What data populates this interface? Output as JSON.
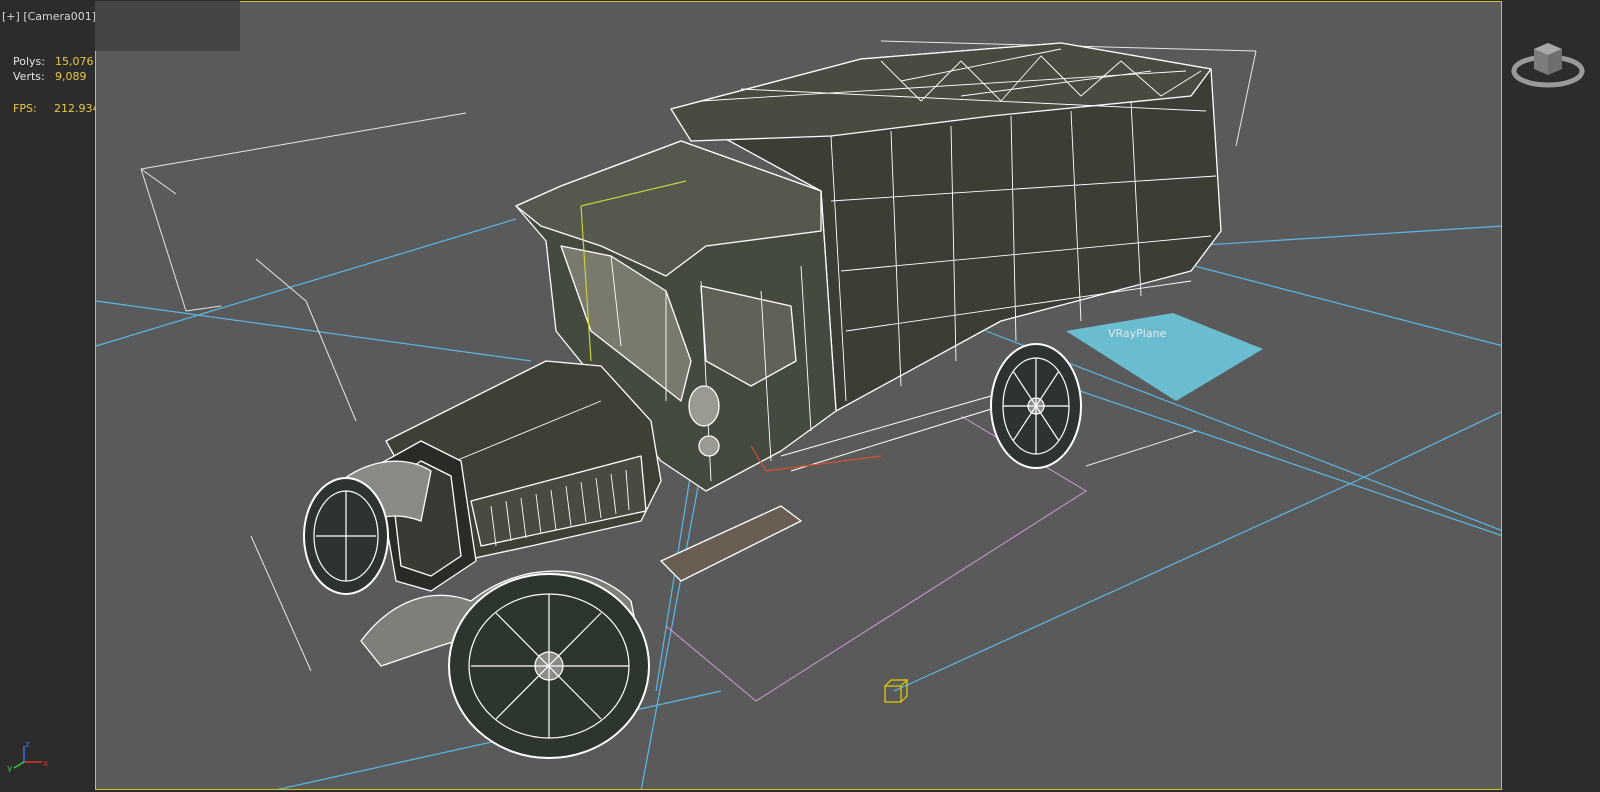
{
  "viewport": {
    "plus_label": "[+]",
    "camera_label": "[Camera001]",
    "accent_border": "#d8c21a"
  },
  "stats": {
    "polys_label": "Polys:",
    "polys_value": "15,076",
    "verts_label": "Verts:",
    "verts_value": "9,089",
    "fps_label": "FPS:",
    "fps_value": "212.934"
  },
  "scene": {
    "object_label": "VRayPlane",
    "object_color": "#6cc6de",
    "light_lines_color": "#5ab8e8",
    "wire_color": "#ffffff"
  },
  "gizmo": {
    "axis_x": "x",
    "axis_y": "y",
    "axis_z": "z"
  },
  "icons": {
    "viewcube": "viewcube-icon",
    "axis": "axis-tripod-icon"
  }
}
